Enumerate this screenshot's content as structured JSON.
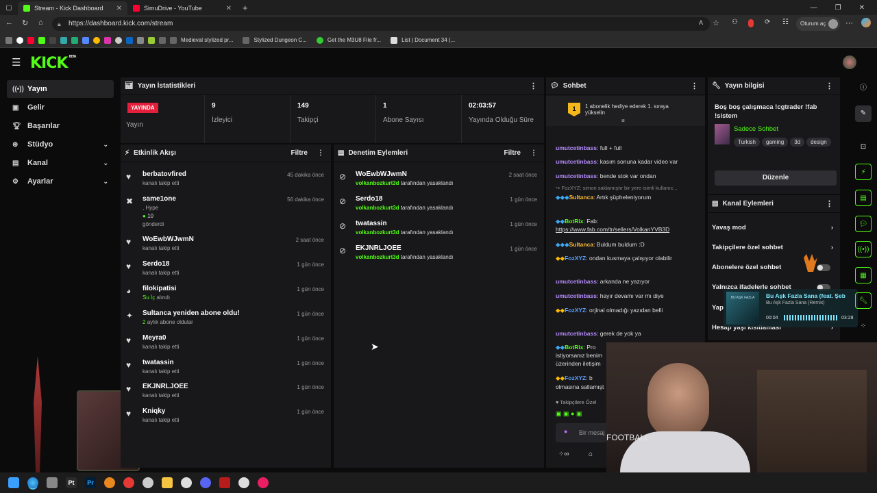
{
  "browser": {
    "tabs": [
      {
        "title": "Stream - Kick Dashboard"
      },
      {
        "title": "SimuDrive - YouTube"
      }
    ],
    "url": "https://dashboard.kick.com/stream",
    "profile_label": "Oturum aç",
    "bookmarks": [
      "Medieval stylized pr...",
      "Stylized Dungeon C...",
      "Get the M3U8 File fr...",
      "List | Document 34 (..."
    ]
  },
  "brand": {
    "logo": "KICK",
    "beta": "BETA",
    "accent": "#53fc18"
  },
  "sidebar": {
    "items": [
      {
        "label": "Yayın",
        "icon": "broadcast-icon"
      },
      {
        "label": "Gelir",
        "icon": "revenue-icon"
      },
      {
        "label": "Başarılar",
        "icon": "trophy-icon"
      },
      {
        "label": "Stüdyo",
        "icon": "studio-icon"
      },
      {
        "label": "Kanal",
        "icon": "channel-icon"
      },
      {
        "label": "Ayarlar",
        "icon": "settings-icon"
      }
    ]
  },
  "stats": {
    "title": "Yayın İstatistikleri",
    "live_badge": "YAYINDA",
    "live_label": "Yayın",
    "viewers_value": "9",
    "viewers_label": "İzleyici",
    "followers_value": "149",
    "followers_label": "Takipçi",
    "subs_value": "1",
    "subs_label": "Abone Sayısı",
    "uptime_value": "02:03:57",
    "uptime_label": "Yayında Olduğu Süre"
  },
  "activity": {
    "title": "Etkinlik Akışı",
    "filter": "Filtre",
    "rows": [
      {
        "name": "berbatovfired",
        "sub": "kanalı takip etti",
        "time": "45 dakika önce",
        "icon": "♥"
      },
      {
        "name": "same1one",
        "sub": ", Hype",
        "sub2": "10",
        "sub3": "gönderdi",
        "time": "56 dakika önce",
        "icon": "✖"
      },
      {
        "name": "WoEwbWJwmN",
        "sub": "kanalı takip etti",
        "time": "2 saat önce",
        "icon": "♥"
      },
      {
        "name": "Serdo18",
        "sub": "kanalı takip etti",
        "time": "1 gün önce",
        "icon": "♥"
      },
      {
        "name": "filokipatisi",
        "sub_green": "Su İç",
        "sub": "alındı",
        "time": "1 gün önce",
        "icon": "◕"
      },
      {
        "name": "Sultanca yeniden abone oldu!",
        "sub_green": "2",
        "sub": "aylık abone oldular",
        "time": "1 gün önce",
        "icon": "✦"
      },
      {
        "name": "Meyra0",
        "sub": "kanalı takip etti",
        "time": "1 gün önce",
        "icon": "♥"
      },
      {
        "name": "twatassin",
        "sub": "kanalı takip etti",
        "time": "1 gün önce",
        "icon": "♥"
      },
      {
        "name": "EKJNRLJOEE",
        "sub": "kanalı takip etti",
        "time": "1 gün önce",
        "icon": "♥"
      },
      {
        "name": "Kniqky",
        "sub": "kanalı takip etti",
        "time": "1 gün önce",
        "icon": "♥"
      }
    ]
  },
  "moderation": {
    "title": "Denetim Eylemleri",
    "filter": "Filtre",
    "rows": [
      {
        "name": "WoEwbWJwmN",
        "mod": "volkanbozkurt3d",
        "action": "tarafından yasaklandı",
        "time": "2 saat önce"
      },
      {
        "name": "Serdo18",
        "mod": "volkanbozkurt3d",
        "action": "tarafından yasaklandı",
        "time": "1 gün önce"
      },
      {
        "name": "twatassin",
        "mod": "volkanbozkurt3d",
        "action": "tarafından yasaklandı",
        "time": "1 gün önce"
      },
      {
        "name": "EKJNRLJOEE",
        "mod": "volkanbozkurt3d",
        "action": "tarafından yasaklandı",
        "time": "1 gün önce"
      }
    ]
  },
  "chat": {
    "title": "Sohbet",
    "pinned": "1 abonelik hediye ederek 1. sıraya yükselin",
    "pinned_rank": "1",
    "messages": [
      {
        "user": "umutcetinbass",
        "text": ": full + full"
      },
      {
        "user": "umutcetinbass",
        "text": ": kasım sonuna kadar video var"
      },
      {
        "user": "umutcetinbass",
        "text": ": bende stok var ondan"
      },
      {
        "reply": "FozXYZ: simon saklamıştır bir yere isimli kullanıc..."
      },
      {
        "user": "Sultanca",
        "text": ": Artık şüpheleniyorum"
      },
      {
        "user": "BotRix",
        "text": ": Fab:"
      },
      {
        "link": "https://www.fab.com/tr/sellers/VolkanYVB3D"
      },
      {
        "user": "Sultanca",
        "text": ": Buldum buldum :D"
      },
      {
        "user": "FozXYZ",
        "text": ": ondan kusmaya çalışıyor olabilir"
      },
      {
        "user": "umutcetinbass",
        "text": ": arkanda ne yazıyor"
      },
      {
        "user": "umutcetinbass",
        "text": ": hayır devamı var mı diye"
      },
      {
        "user": "FozXYZ",
        "text": ": orjinal olmadığı yazıdan belli"
      },
      {
        "user": "umutcetinbass",
        "text": ": gerek de yok ya"
      },
      {
        "user": "BotRix",
        "text": ": Pro"
      },
      {
        "cont": "istiyorsanız benim"
      },
      {
        "cont": "üzerinden iletişim"
      },
      {
        "user": "FozXYZ",
        "text": ": b"
      },
      {
        "cont": "olmasına sallamışt"
      }
    ],
    "followers_only": "Takipçilere Özel",
    "input_placeholder": "Bir mesaj"
  },
  "stream_info": {
    "title": "Yayın bilgisi",
    "stream_title": "Boş boş çalışmaca !cgtrader !fab !sistem",
    "category": "Sadece Sohbet",
    "tags": [
      "Turkish",
      "gaming",
      "3d",
      "design"
    ],
    "edit": "Düzenle"
  },
  "channel_actions": {
    "title": "Kanal Eylemleri",
    "items": [
      {
        "label": "Yavaş mod",
        "kind": "chevron"
      },
      {
        "label": "Takipçilere özel sohbet",
        "kind": "chevron"
      },
      {
        "label": "Abonelere özel sohbet",
        "kind": "toggle"
      },
      {
        "label": "Yalnızca ifadelerle sohbet",
        "kind": "toggle"
      },
      {
        "label": "Yap",
        "kind": "chevron"
      },
      {
        "label": "Hesap yaşı kısıtlaması",
        "kind": "chevron"
      }
    ]
  },
  "music": {
    "title": "Bu Aşk Fazla Sana (feat. Şeb",
    "subtitle": "Bu Aşk Fazla Sana (Remix)",
    "cover": "BU AŞK FAZLA",
    "elapsed": "00:04",
    "total": "03:28"
  },
  "webcam": {
    "shirt_text": "FOOTBALL"
  }
}
